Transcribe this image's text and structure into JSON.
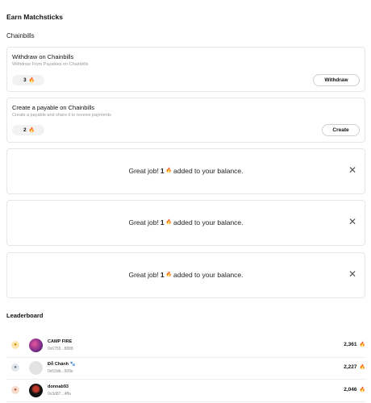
{
  "header": {
    "title": "Earn Matchsticks",
    "section": "Chainbills"
  },
  "tasks": [
    {
      "title": "Withdraw on Chainbills",
      "subtitle": "Withdraw From Payables on Chainbills",
      "reward": "3",
      "button": "Withdraw"
    },
    {
      "title": "Create a payable on Chainbills",
      "subtitle": "Create a payable and share it to receive payments",
      "reward": "2",
      "button": "Create"
    }
  ],
  "toasts": [
    {
      "prefix": "Great job!",
      "amount": "1",
      "suffix": "added to your balance.",
      "close": "✕"
    },
    {
      "prefix": "Great job!",
      "amount": "1",
      "suffix": "added to your balance.",
      "close": "✕"
    },
    {
      "prefix": "Great job!",
      "amount": "1",
      "suffix": "added to your balance.",
      "close": "✕"
    }
  ],
  "leaderboard": {
    "title": "Leaderboard",
    "rows": [
      {
        "name": "CAMP FIRE",
        "address": "0x6755...8888",
        "score": "2,361",
        "rank_color": "#f0b429"
      },
      {
        "name": "Đỗ Chánh 🐾",
        "address": "0x53db...509e",
        "score": "2,227",
        "rank_color": "#9aa3b2"
      },
      {
        "name": "donnab93",
        "address": "0x3d87...4ffa",
        "score": "2,046",
        "rank_color": "#d9865b"
      }
    ]
  },
  "icons": {
    "fire": "fire-icon",
    "close": "close-icon",
    "medal": "medal-icon"
  },
  "colors": {
    "accent": "#f05a28"
  }
}
